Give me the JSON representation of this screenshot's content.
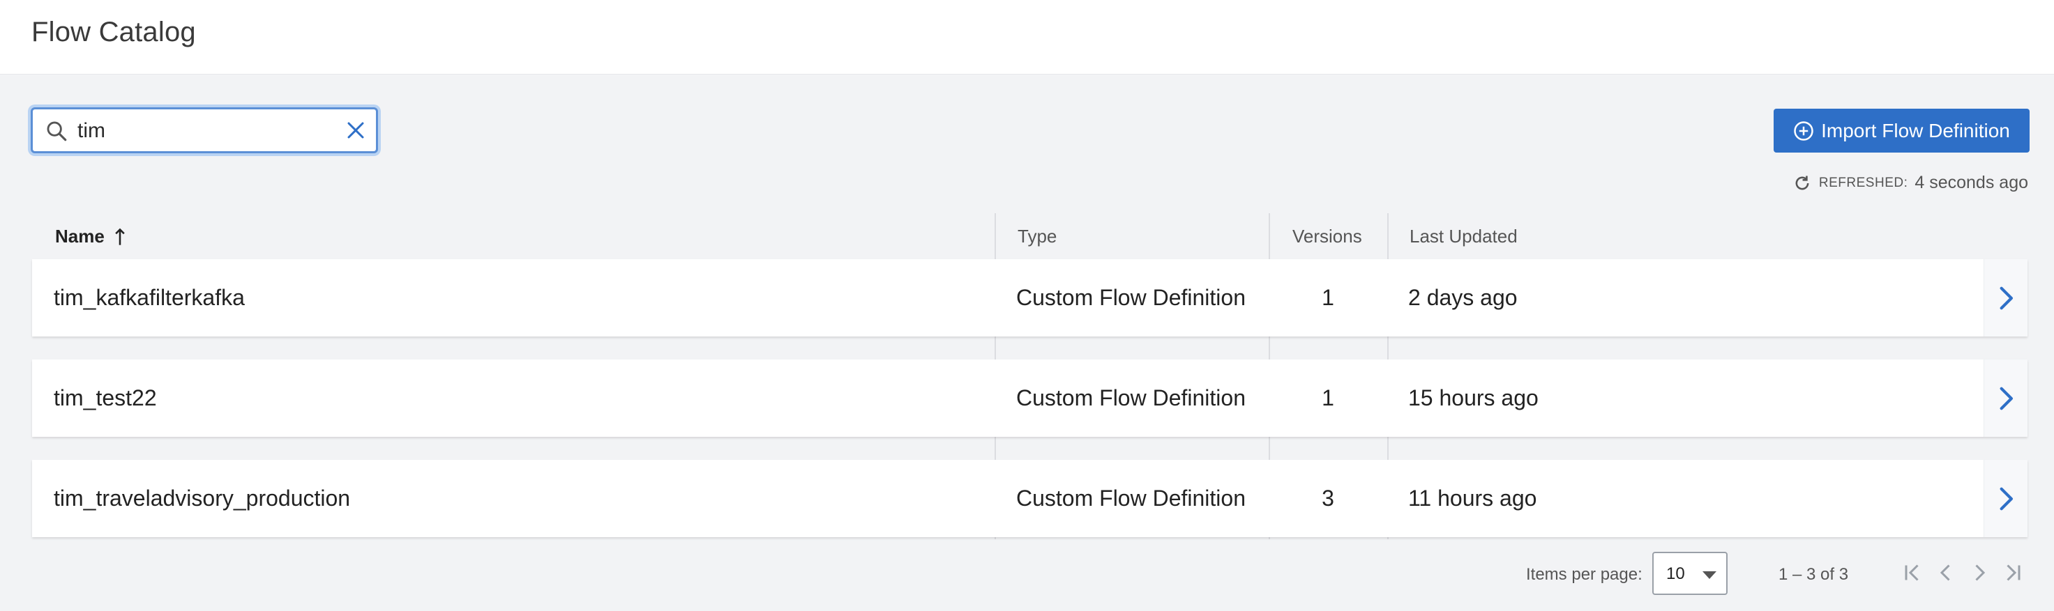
{
  "header": {
    "title": "Flow Catalog"
  },
  "search": {
    "value": "tim"
  },
  "toolbar": {
    "import_label": "Import Flow Definition"
  },
  "refresh": {
    "label": "REFRESHED:",
    "value": "4 seconds ago"
  },
  "table": {
    "columns": [
      "Name",
      "Type",
      "Versions",
      "Last Updated"
    ],
    "sort": {
      "column": "Name",
      "direction": "ascending"
    },
    "rows": [
      {
        "name": "tim_kafkafilterkafka",
        "type": "Custom Flow Definition",
        "versions": "1",
        "updated": "2 days ago"
      },
      {
        "name": "tim_test22",
        "type": "Custom Flow Definition",
        "versions": "1",
        "updated": "15 hours ago"
      },
      {
        "name": "tim_traveladvisory_production",
        "type": "Custom Flow Definition",
        "versions": "3",
        "updated": "11 hours ago"
      }
    ]
  },
  "pagination": {
    "items_per_page_label": "Items per page:",
    "items_per_page": "10",
    "range": "1 – 3 of 3"
  },
  "colors": {
    "accent": "#2e6fc7",
    "background": "#f2f3f5",
    "focus_ring": "#b9d3f3"
  },
  "icons": {
    "search": "search-icon",
    "clear": "close-icon",
    "import": "plus-circle-icon",
    "refresh": "refresh-icon",
    "sort": "arrow-up-icon",
    "row_open": "chevron-right-icon"
  }
}
